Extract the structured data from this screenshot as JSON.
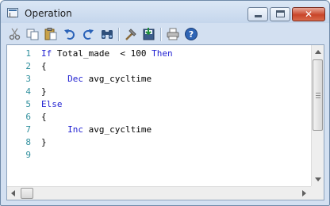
{
  "window": {
    "title": "Operation"
  },
  "title_buttons": {
    "minimize": "",
    "maximize": "",
    "close": "✕"
  },
  "toolbar": {
    "icons": [
      "scissors-icon",
      "copy-icon",
      "paste-icon",
      "undo-icon",
      "redo-icon",
      "find-icon",
      "build-icon",
      "save-icon",
      "print-icon",
      "help-icon"
    ]
  },
  "editor": {
    "line_numbers": [
      "1",
      "2",
      "3",
      "4",
      "5",
      "6",
      "7",
      "8",
      "9"
    ],
    "lines": [
      [
        {
          "t": "If",
          "k": true
        },
        {
          "t": " Total_made  < 100 ",
          "k": false
        },
        {
          "t": "Then",
          "k": true
        }
      ],
      [
        {
          "t": "{",
          "k": false
        }
      ],
      [
        {
          "t": "     ",
          "k": false
        },
        {
          "t": "Dec",
          "k": true
        },
        {
          "t": " avg_cycltime",
          "k": false
        }
      ],
      [
        {
          "t": "}",
          "k": false
        }
      ],
      [
        {
          "t": "Else",
          "k": true
        }
      ],
      [
        {
          "t": "{",
          "k": false
        }
      ],
      [
        {
          "t": "     ",
          "k": false
        },
        {
          "t": "Inc",
          "k": true
        },
        {
          "t": " avg_cycltime",
          "k": false
        }
      ],
      [
        {
          "t": "}",
          "k": false
        }
      ],
      []
    ]
  },
  "colors": {
    "keyword": "#1f1fd1",
    "line_number": "#2f8f9d"
  }
}
